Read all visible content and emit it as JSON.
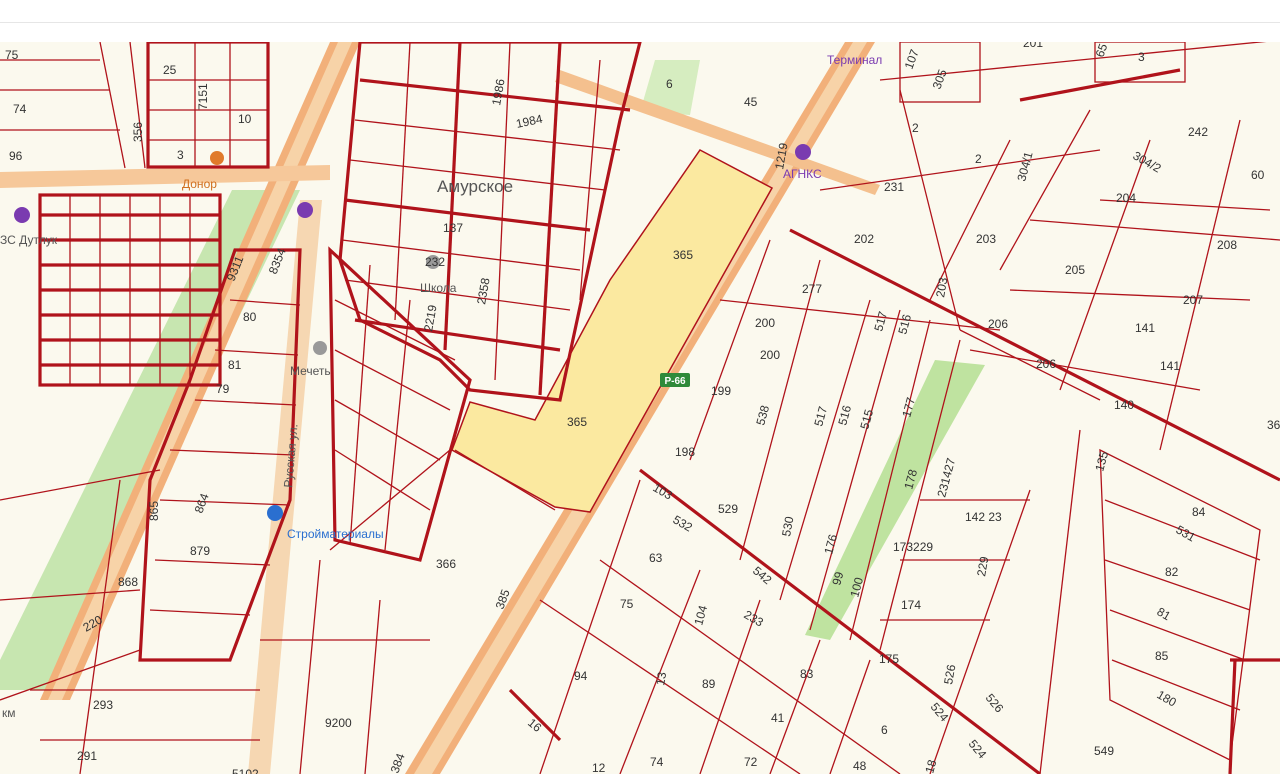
{
  "colors": {
    "parcel_line": "#b0131b",
    "background": "#fbf9ee",
    "highlight_parcel": "#fbe9a0",
    "green_strip": "#bfe3a0",
    "road": "#f2b07a",
    "road_core": "#f7d3a8"
  },
  "places": {
    "settlement": "Амурское",
    "mosque": "Мечеть",
    "school": "Школа",
    "street": "Русская ул.",
    "shop": "Стройматериалы",
    "gas_left": "АГНКС",
    "gas_left_short": "ЗС Дутлук",
    "terminal": "Терминал",
    "donor": "Донор",
    "km": "км"
  },
  "highway_badge": "Р-66",
  "parcels": {
    "p75": "75",
    "p74": "74",
    "p96": "96",
    "p25": "25",
    "p7151": "7151",
    "p10": "10",
    "p356": "356",
    "p3": "3",
    "p9311": "9311",
    "p8354": "8354",
    "p80": "80",
    "p81": "81",
    "p79": "79",
    "p865": "865",
    "p864": "864",
    "p879": "879",
    "p868": "868",
    "p220": "220",
    "p293": "293",
    "p291": "291",
    "p9200": "9200",
    "p384": "384",
    "p366": "366",
    "p385": "385",
    "p1986": "1986",
    "p1984": "1984",
    "p137": "137",
    "p232": "232",
    "p2358": "2358",
    "p2219": "2219",
    "p6": "6",
    "p45": "45",
    "p1219": "1219",
    "p365a": "365",
    "p365b": "365",
    "p2a": "2",
    "p2b": "2",
    "p231": "231",
    "p202": "202",
    "p203a": "203",
    "p203b": "203",
    "p304_1": "304/1",
    "p304_2": "304/2",
    "p242": "242",
    "p60": "60",
    "p204": "204",
    "p208": "208",
    "p205": "205",
    "p207": "207",
    "p206a": "206",
    "p206b": "206",
    "p141a": "141",
    "p141b": "141",
    "p140": "140",
    "p36": "36",
    "p107": "107",
    "p305": "305",
    "p65": "65",
    "p3b": "3",
    "p201": "201",
    "p277": "277",
    "p200a": "200",
    "p200b": "200",
    "p199": "199",
    "p538": "538",
    "p517a": "517",
    "p516a": "516",
    "p517b": "517",
    "p516b": "516",
    "p515": "515",
    "p177": "177",
    "p198": "198",
    "p103": "103",
    "p529": "529",
    "p530": "530",
    "p532": "532",
    "p176": "176",
    "p178": "178",
    "p231427": "231427",
    "p14223": "142 23",
    "p173229": "173229",
    "p229": "229",
    "p63": "63",
    "p75b": "75",
    "p104": "104",
    "p542": "542",
    "p99": "99",
    "p100": "100",
    "p174": "174",
    "p94": "94",
    "p13": "13",
    "p89": "89",
    "p233": "233",
    "p83": "83",
    "p175": "175",
    "p74b": "74",
    "p41": "41",
    "p72": "72",
    "p16": "16",
    "p12": "12",
    "p6b": "6",
    "p48": "48",
    "p526a": "526",
    "p526b": "526",
    "p524a": "524",
    "p524b": "524",
    "p549": "549",
    "p135": "135",
    "p84": "84",
    "p531": "531",
    "p82": "82",
    "p81b": "81",
    "p85": "85",
    "p180": "180",
    "p18": "18",
    "p5102": "5102"
  }
}
